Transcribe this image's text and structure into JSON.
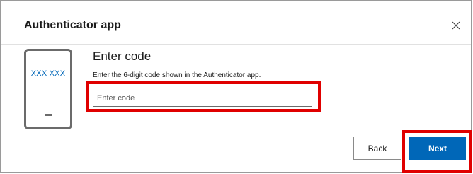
{
  "dialog": {
    "title": "Authenticator app",
    "close_icon": "close-icon"
  },
  "phone_illustration": {
    "code_text": "XXX XXX"
  },
  "content": {
    "heading": "Enter code",
    "instruction": "Enter the 6-digit code shown in the Authenticator app."
  },
  "code_input": {
    "placeholder": "Enter code",
    "value": ""
  },
  "buttons": {
    "back_label": "Back",
    "next_label": "Next"
  },
  "colors": {
    "accent": "#0067b8",
    "highlight": "#e00000"
  }
}
